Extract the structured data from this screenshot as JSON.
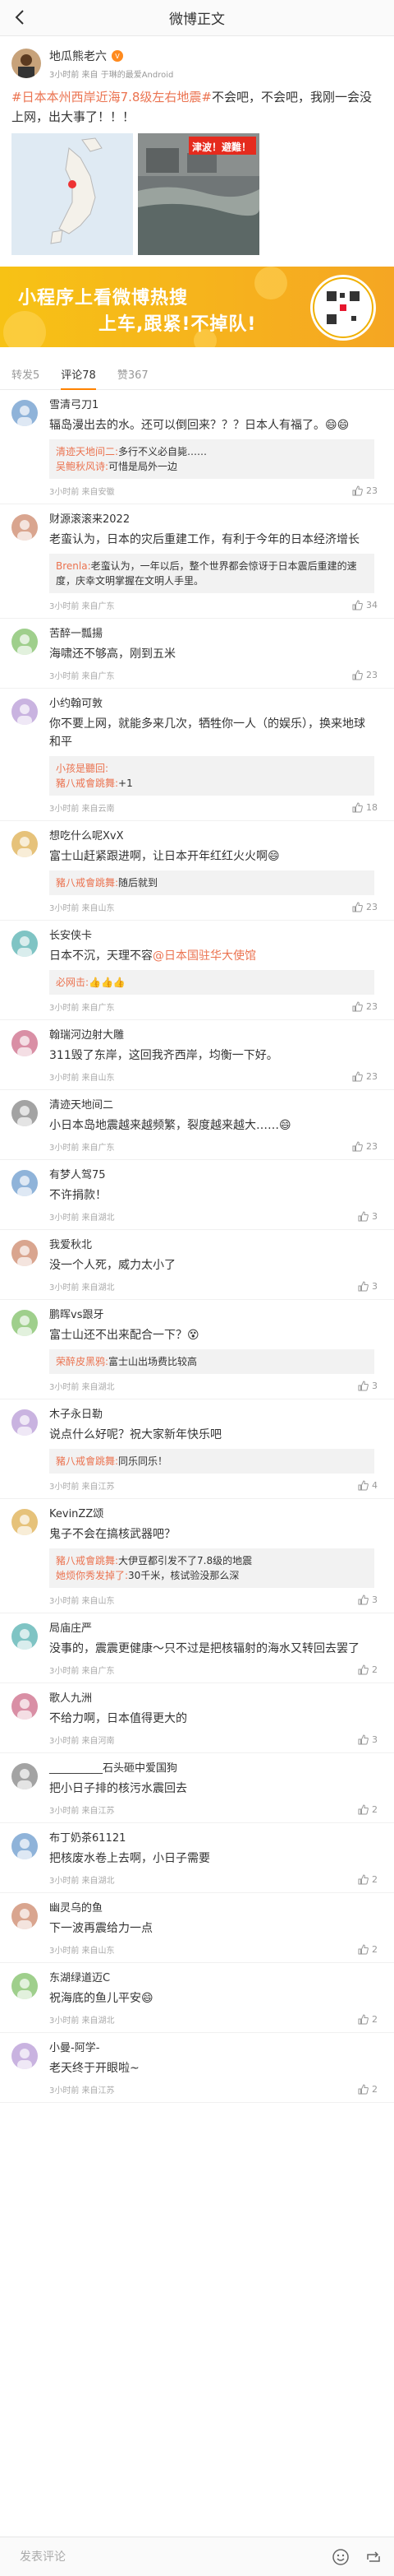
{
  "header": {
    "title": "微博正文"
  },
  "post": {
    "author": "地瓜熊老六",
    "sub": "3小时前 来自 于琳的最爱Android",
    "tag": "#日本本州西岸近海7.8级左右地震#",
    "text": "不会吧，不会吧，我刚一会没上网，出大事了！！！",
    "flood_caption": "津波！避難！"
  },
  "ad": {
    "line1": "小程序上看微博热搜",
    "line2": "上车,跟紧!不掉队!"
  },
  "tabs": [
    {
      "label": "转发5"
    },
    {
      "label": "评论78"
    },
    {
      "label": "赞367"
    }
  ],
  "comments": [
    {
      "name": "雪清弓刀1",
      "text": "辐岛漫出去的水。还可以倒回来？？？日本人有福了。",
      "emoji": "😄😄",
      "time": "3小时前 来自安徽",
      "likes": "23",
      "replies": [
        {
          "name": "清迹天地间二:",
          "text": "多行不义必自毙……"
        },
        {
          "name": "吴鲍秋风诗:",
          "text": "可惜是局外一边"
        }
      ]
    },
    {
      "name": "财源滚滚来2022",
      "text": "老蛮认为，日本的灾后重建工作，有利于今年的日本经济增长",
      "emoji": "",
      "time": "3小时前 来自广东",
      "likes": "34",
      "replies": [
        {
          "name": "Brenla:",
          "text": "老蛮认为，一年以后，整个世界都会惊讶于日本震后重建的速度，庆幸文明掌握在文明人手里。"
        }
      ]
    },
    {
      "name": "苦醉一瓢揚",
      "text": "海啸还不够高，刚到五米",
      "emoji": "",
      "time": "3小时前 来自广东",
      "likes": "23",
      "replies": []
    },
    {
      "name": "小约翰可敦",
      "text": "你不要上网，就能多来几次，牺牲你一人（的娱乐），换来地球和平",
      "emoji": "",
      "time": "3小时前 来自云南",
      "likes": "18",
      "replies": [
        {
          "name": "小孩是聽回:",
          "text": ""
        },
        {
          "name": "豬八戒會跳舞:",
          "text": "+1"
        }
      ]
    },
    {
      "name": "想吃什么呢XvX",
      "text": "富士山赶紧跟进啊，让日本开年红红火火啊",
      "emoji": "😄",
      "time": "3小时前 来自山东",
      "likes": "23",
      "replies": [
        {
          "name": "豬八戒會跳舞:",
          "text": "随后就到"
        }
      ]
    },
    {
      "name": "长安侠卡",
      "text": "日本不沉，天理不容",
      "mention": "@日本国驻华大使馆",
      "emoji": "",
      "time": "3小时前 来自广东",
      "likes": "23",
      "replies": [
        {
          "name": "必网击:",
          "text": "👍👍👍"
        }
      ]
    },
    {
      "name": "翰瑞河边射大雕",
      "text": "311毁了东岸，这回我齐西岸，均衡一下好。",
      "emoji": "",
      "time": "3小时前 来自山东",
      "likes": "23",
      "replies": []
    },
    {
      "name": "清迹天地间二",
      "text": "小日本岛地震越来越频繁，裂度越来越大……",
      "emoji": "😄",
      "time": "3小时前 来自广东",
      "likes": "23",
      "replies": []
    },
    {
      "name": "有梦人驾75",
      "text": "不许捐款！",
      "emoji": "",
      "time": "3小时前 来自湖北",
      "likes": "3",
      "replies": []
    },
    {
      "name": "我爱秋北",
      "text": "没一个人死，威力太小了",
      "emoji": "",
      "time": "3小时前 来自湖北",
      "likes": "3",
      "replies": []
    },
    {
      "name": "鹏晖vs跟牙",
      "text": "富士山还不出来配合一下？",
      "emoji": "😵",
      "time": "3小时前 来自湖北",
      "likes": "3",
      "replies": [
        {
          "name": "荣醉皮黑鸦:",
          "text": "富士山出场费比较高"
        }
      ]
    },
    {
      "name": "木子永日勒",
      "text": "说点什么好呢？祝大家新年快乐吧",
      "emoji": "",
      "time": "3小时前 来自江苏",
      "likes": "4",
      "replies": [
        {
          "name": "豬八戒會跳舞:",
          "text": "同乐同乐！"
        }
      ]
    },
    {
      "name": "KevinZZ颂",
      "text": "鬼子不会在搞核武器吧？",
      "emoji": "",
      "time": "3小时前 来自山东",
      "likes": "3",
      "replies": [
        {
          "name": "豬八戒會跳舞:",
          "text": "大伊豆都引发不了7.8级的地震"
        },
        {
          "name": "她烦你秀发掉了:",
          "text": "30千米，核试验没那么深"
        }
      ]
    },
    {
      "name": "局庙庄严",
      "text": "没事的，震震更健康～只不过是把核辐射的海水又转回去罢了",
      "emoji": "",
      "time": "3小时前 来自广东",
      "likes": "2",
      "replies": []
    },
    {
      "name": "歌人九洲",
      "text": "不给力啊，日本值得更大的",
      "emoji": "",
      "time": "3小时前 来自河南",
      "likes": "3",
      "replies": []
    },
    {
      "name": "__________石头砸中爱国狗",
      "text": "把小日子排的核污水震回去",
      "emoji": "",
      "time": "3小时前 来自江苏",
      "likes": "2",
      "replies": []
    },
    {
      "name": "布丁奶茶61121",
      "text": "把核废水卷上去啊，小日子需要",
      "emoji": "",
      "time": "3小时前 来自湖北",
      "likes": "2",
      "replies": []
    },
    {
      "name": "幽灵乌的鱼",
      "text": "下一波再震给力一点",
      "emoji": "",
      "time": "3小时前 来自山东",
      "likes": "2",
      "replies": []
    },
    {
      "name": "东湖绿道迈C",
      "text": "祝海底的鱼儿平安",
      "emoji": "😄",
      "time": "3小时前 来自湖北",
      "likes": "2",
      "replies": []
    },
    {
      "name": "小曼-阿学-",
      "text": "老天终于开眼啦~",
      "emoji": "",
      "time": "3小时前 来自江苏",
      "likes": "2",
      "replies": []
    }
  ],
  "bottom": {
    "placeholder": "发表评论"
  }
}
